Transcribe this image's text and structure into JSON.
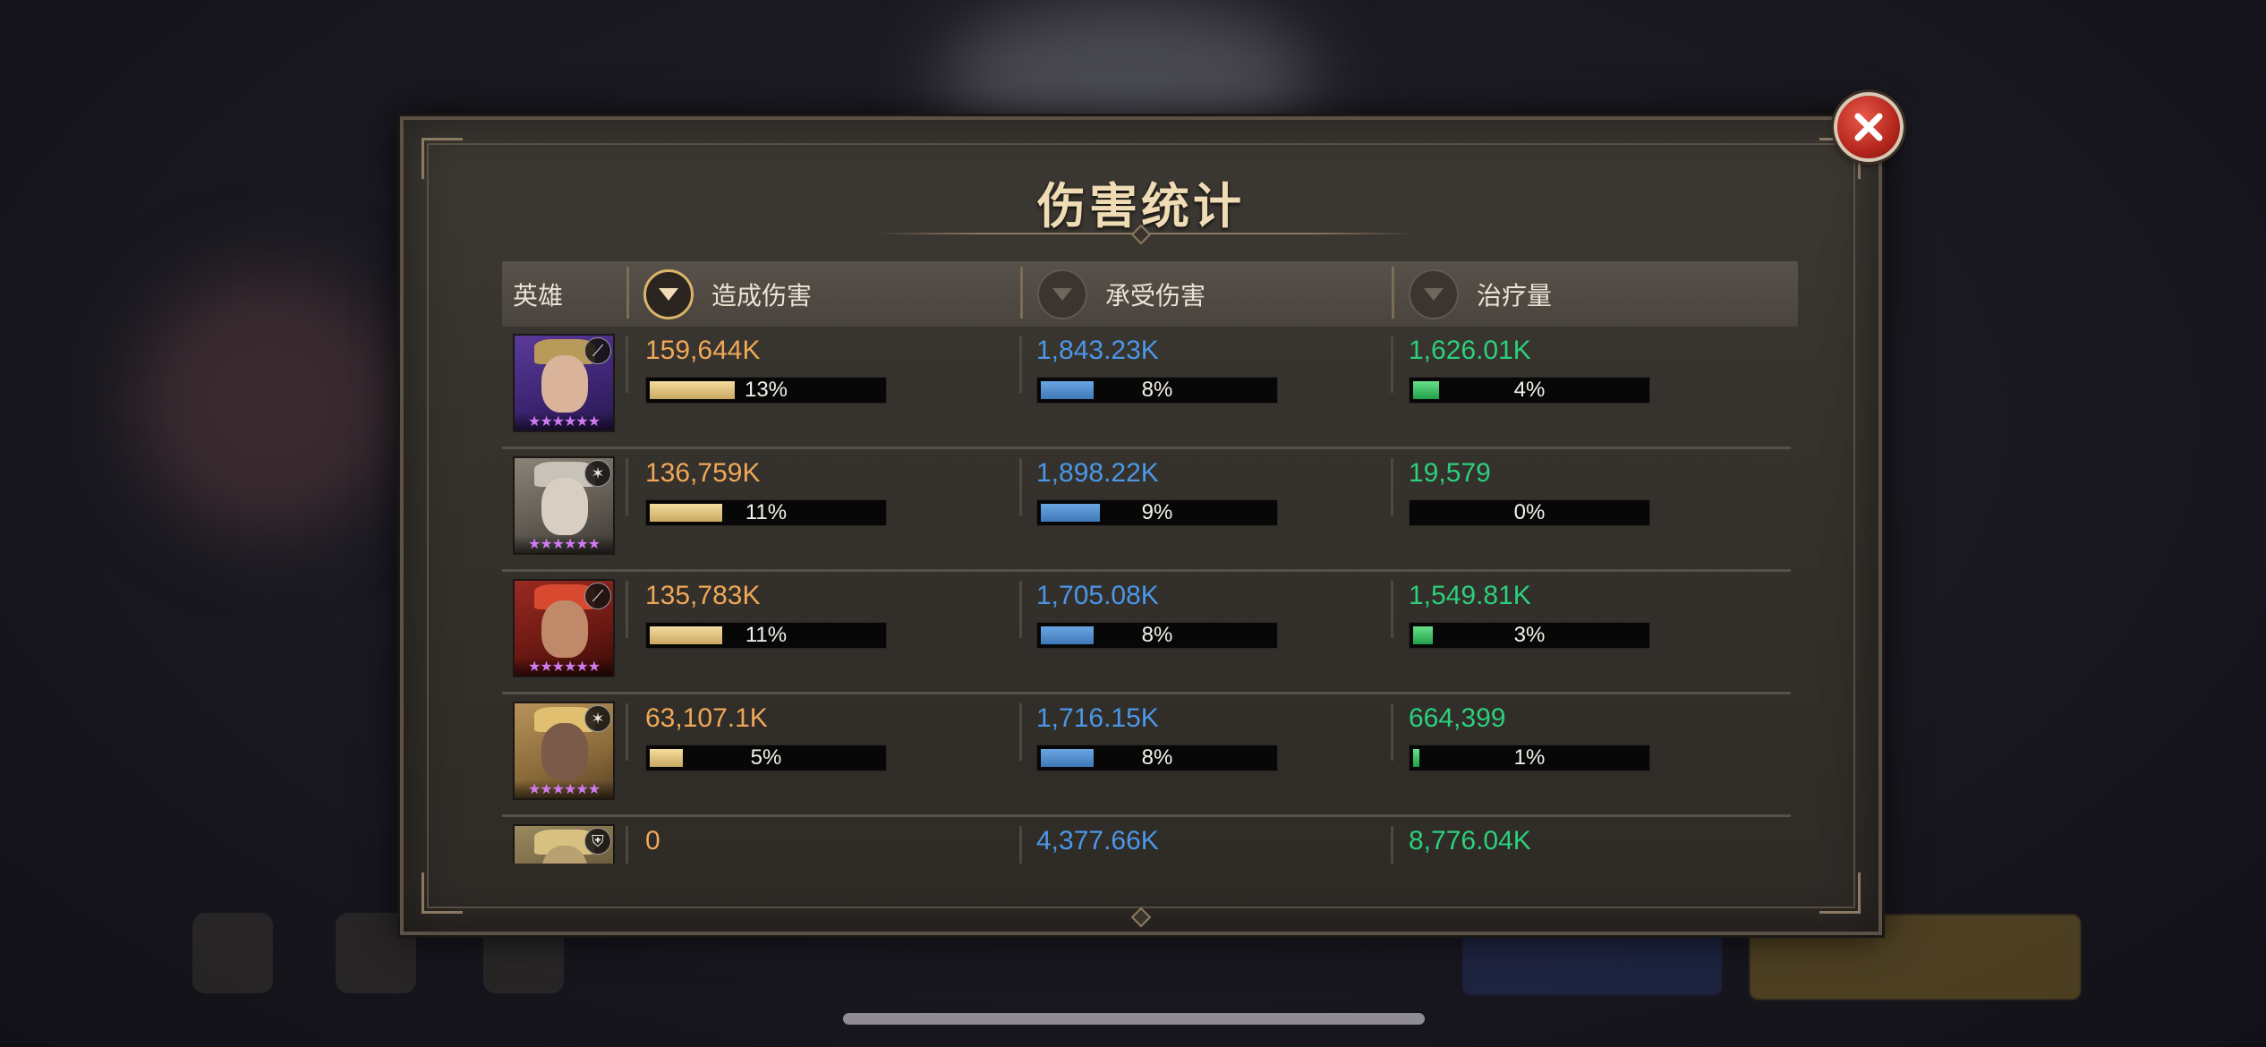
{
  "dialog": {
    "title": "伤害统计"
  },
  "table": {
    "headers": {
      "hero": "英雄",
      "damage_dealt": "造成伤害",
      "damage_taken": "承受伤害",
      "healing": "治疗量"
    },
    "sort_active": "damage_dealt",
    "rows": [
      {
        "hero_class_icon": "bow-icon",
        "hero_stars": "★★★★★★",
        "damage_dealt": "159,644K",
        "damage_pct": "13%",
        "damage_frac": 0.13,
        "damage_taken": "1,843.23K",
        "taken_pct": "8%",
        "taken_frac": 0.08,
        "healing": "1,626.01K",
        "heal_pct": "4%",
        "heal_frac": 0.04
      },
      {
        "hero_class_icon": "staff-icon",
        "hero_stars": "★★★★★★",
        "damage_dealt": "136,759K",
        "damage_pct": "11%",
        "damage_frac": 0.11,
        "damage_taken": "1,898.22K",
        "taken_pct": "9%",
        "taken_frac": 0.09,
        "healing": "19,579",
        "heal_pct": "0%",
        "heal_frac": 0.0
      },
      {
        "hero_class_icon": "bow-icon",
        "hero_stars": "★★★★★★",
        "damage_dealt": "135,783K",
        "damage_pct": "11%",
        "damage_frac": 0.11,
        "damage_taken": "1,705.08K",
        "taken_pct": "8%",
        "taken_frac": 0.08,
        "healing": "1,549.81K",
        "heal_pct": "3%",
        "heal_frac": 0.03
      },
      {
        "hero_class_icon": "staff-icon",
        "hero_stars": "★★★★★★",
        "damage_dealt": "63,107.1K",
        "damage_pct": "5%",
        "damage_frac": 0.05,
        "damage_taken": "1,716.15K",
        "taken_pct": "8%",
        "taken_frac": 0.08,
        "healing": "664,399",
        "heal_pct": "1%",
        "heal_frac": 0.01
      },
      {
        "hero_class_icon": "shield-icon",
        "hero_stars": "",
        "damage_dealt": "0",
        "damage_pct": "",
        "damage_frac": 0.0,
        "damage_taken": "4,377.66K",
        "taken_pct": "",
        "taken_frac": 0.0,
        "healing": "8,776.04K",
        "heal_pct": "",
        "heal_frac": 0.0
      }
    ]
  },
  "colors": {
    "damage_text": "#f0a858",
    "taken_text": "#4b97e8",
    "heal_text": "#2cd07c",
    "title_text": "#f0dcb4",
    "close_button": "#c8302a",
    "star": "#d07cf0"
  }
}
